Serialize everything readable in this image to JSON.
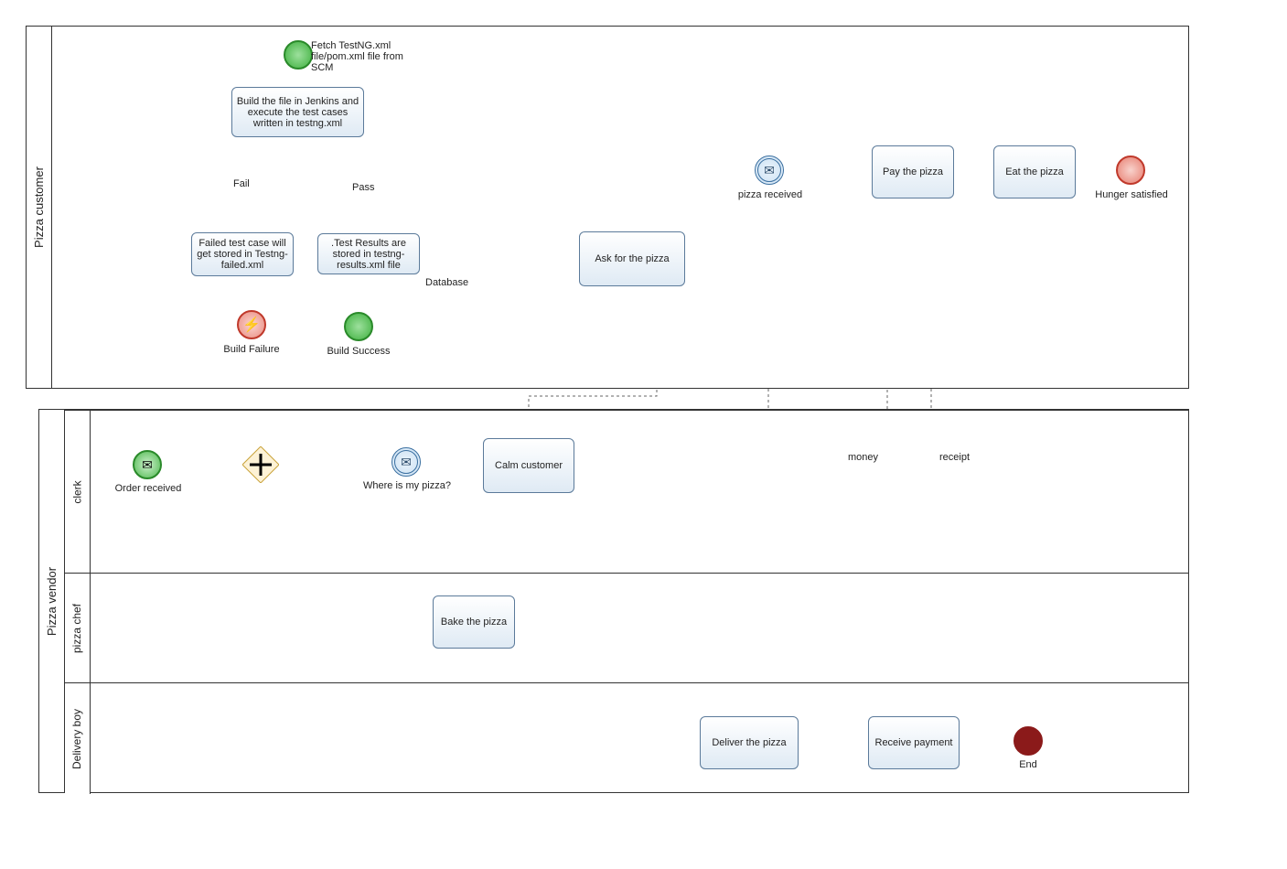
{
  "pool1": {
    "label": "Pizza customer"
  },
  "pool2": {
    "label": "Pizza vendor",
    "lane1": "clerk",
    "lane2": "pizza chef",
    "lane3": "Delivery boy"
  },
  "events": {
    "start": "Fetch TestNG.xml file/pom.xml file from SCM",
    "build_failure": "Build Failure",
    "build_success": "Build Success",
    "pizza_received": "pizza received",
    "hunger_satisfied": "Hunger satisfied",
    "order_received": "Order received",
    "where_pizza": "Where is my pizza?",
    "end": "End"
  },
  "tasks": {
    "build_file": "Build the file in Jenkins and execute the test cases written in testng.xml",
    "failed_tc": "Failed test case will get stored in Testng-failed.xml",
    "results_stored": ".Test Results are stored in testng-results.xml file",
    "ask_pizza": "Ask for the pizza",
    "pay_pizza": "Pay the pizza",
    "eat_pizza": "Eat the pizza",
    "calm": "Calm customer",
    "bake": "Bake the pizza",
    "deliver": "Deliver the pizza",
    "receive_pay": "Receive payment"
  },
  "edges": {
    "fail": "Fail",
    "pass": "Pass",
    "database": "Database",
    "money": "money",
    "receipt": "receipt"
  },
  "icons": {
    "envelope": "✉",
    "bolt": "⚡",
    "plus": "+"
  },
  "chart_data": {
    "type": "bpmn-diagram",
    "pools": [
      {
        "name": "Pizza customer",
        "lanes": [
          {
            "name": "",
            "nodes": [
              {
                "id": "start",
                "type": "start-event",
                "label": "Fetch TestNG.xml file/pom.xml file from SCM"
              },
              {
                "id": "build",
                "type": "task",
                "label": "Build the file in Jenkins and execute the test cases written in testng.xml"
              },
              {
                "id": "failedtc",
                "type": "task",
                "label": "Failed test case will get stored in Testng-failed.xml"
              },
              {
                "id": "results",
                "type": "task",
                "label": ".Test Results are stored in testng-results.xml file"
              },
              {
                "id": "buildfail",
                "type": "end-error",
                "label": "Build Failure"
              },
              {
                "id": "buildok",
                "type": "end-event",
                "label": "Build Success"
              },
              {
                "id": "ask",
                "type": "task",
                "label": "Ask for the pizza"
              },
              {
                "id": "pizzarecv",
                "type": "intermediate-message-catch",
                "label": "pizza received"
              },
              {
                "id": "pay",
                "type": "task",
                "label": "Pay the pizza"
              },
              {
                "id": "eat",
                "type": "task",
                "label": "Eat the pizza"
              },
              {
                "id": "hunger",
                "type": "end-event",
                "label": "Hunger satisfied"
              }
            ]
          }
        ]
      },
      {
        "name": "Pizza vendor",
        "lanes": [
          {
            "name": "clerk",
            "nodes": [
              {
                "id": "orderrecv",
                "type": "start-message",
                "label": "Order received"
              },
              {
                "id": "gw",
                "type": "parallel-gateway",
                "label": ""
              },
              {
                "id": "where",
                "type": "intermediate-message-catch",
                "label": "Where is my pizza?"
              },
              {
                "id": "calm",
                "type": "task",
                "label": "Calm customer"
              }
            ]
          },
          {
            "name": "pizza chef",
            "nodes": [
              {
                "id": "bake",
                "type": "task",
                "label": "Bake the pizza"
              }
            ]
          },
          {
            "name": "Delivery boy",
            "nodes": [
              {
                "id": "deliver",
                "type": "task",
                "label": "Deliver the pizza"
              },
              {
                "id": "recvpay",
                "type": "task",
                "label": "Receive payment"
              },
              {
                "id": "end",
                "type": "terminate-end",
                "label": "End"
              }
            ]
          }
        ]
      }
    ],
    "sequence_flows": [
      {
        "from": "start",
        "to": "build"
      },
      {
        "from": "build",
        "to": "failedtc",
        "label": "Fail"
      },
      {
        "from": "build",
        "to": "results",
        "label": "Pass"
      },
      {
        "from": "failedtc",
        "to": "buildfail"
      },
      {
        "from": "results",
        "to": "buildok"
      },
      {
        "from": "results",
        "to": "ask",
        "label": "Database"
      },
      {
        "from": "ask",
        "to": "pizzarecv"
      },
      {
        "from": "pizzarecv",
        "to": "pay"
      },
      {
        "from": "pay",
        "to": "eat"
      },
      {
        "from": "eat",
        "to": "hunger"
      },
      {
        "from": "orderrecv",
        "to": "gw"
      },
      {
        "from": "gw",
        "to": "where"
      },
      {
        "from": "where",
        "to": "calm"
      },
      {
        "from": "calm",
        "to": "where"
      },
      {
        "from": "gw",
        "to": "bake"
      },
      {
        "from": "bake",
        "to": "deliver"
      },
      {
        "from": "deliver",
        "to": "recvpay"
      },
      {
        "from": "recvpay",
        "to": "end"
      }
    ],
    "message_flows": [
      {
        "from": "ask",
        "to": "calm"
      },
      {
        "from": "deliver",
        "to": "pizzarecv"
      },
      {
        "from": "pay",
        "to": "recvpay",
        "label": "money"
      },
      {
        "from": "recvpay",
        "to": "pay",
        "label": "receipt"
      }
    ]
  }
}
